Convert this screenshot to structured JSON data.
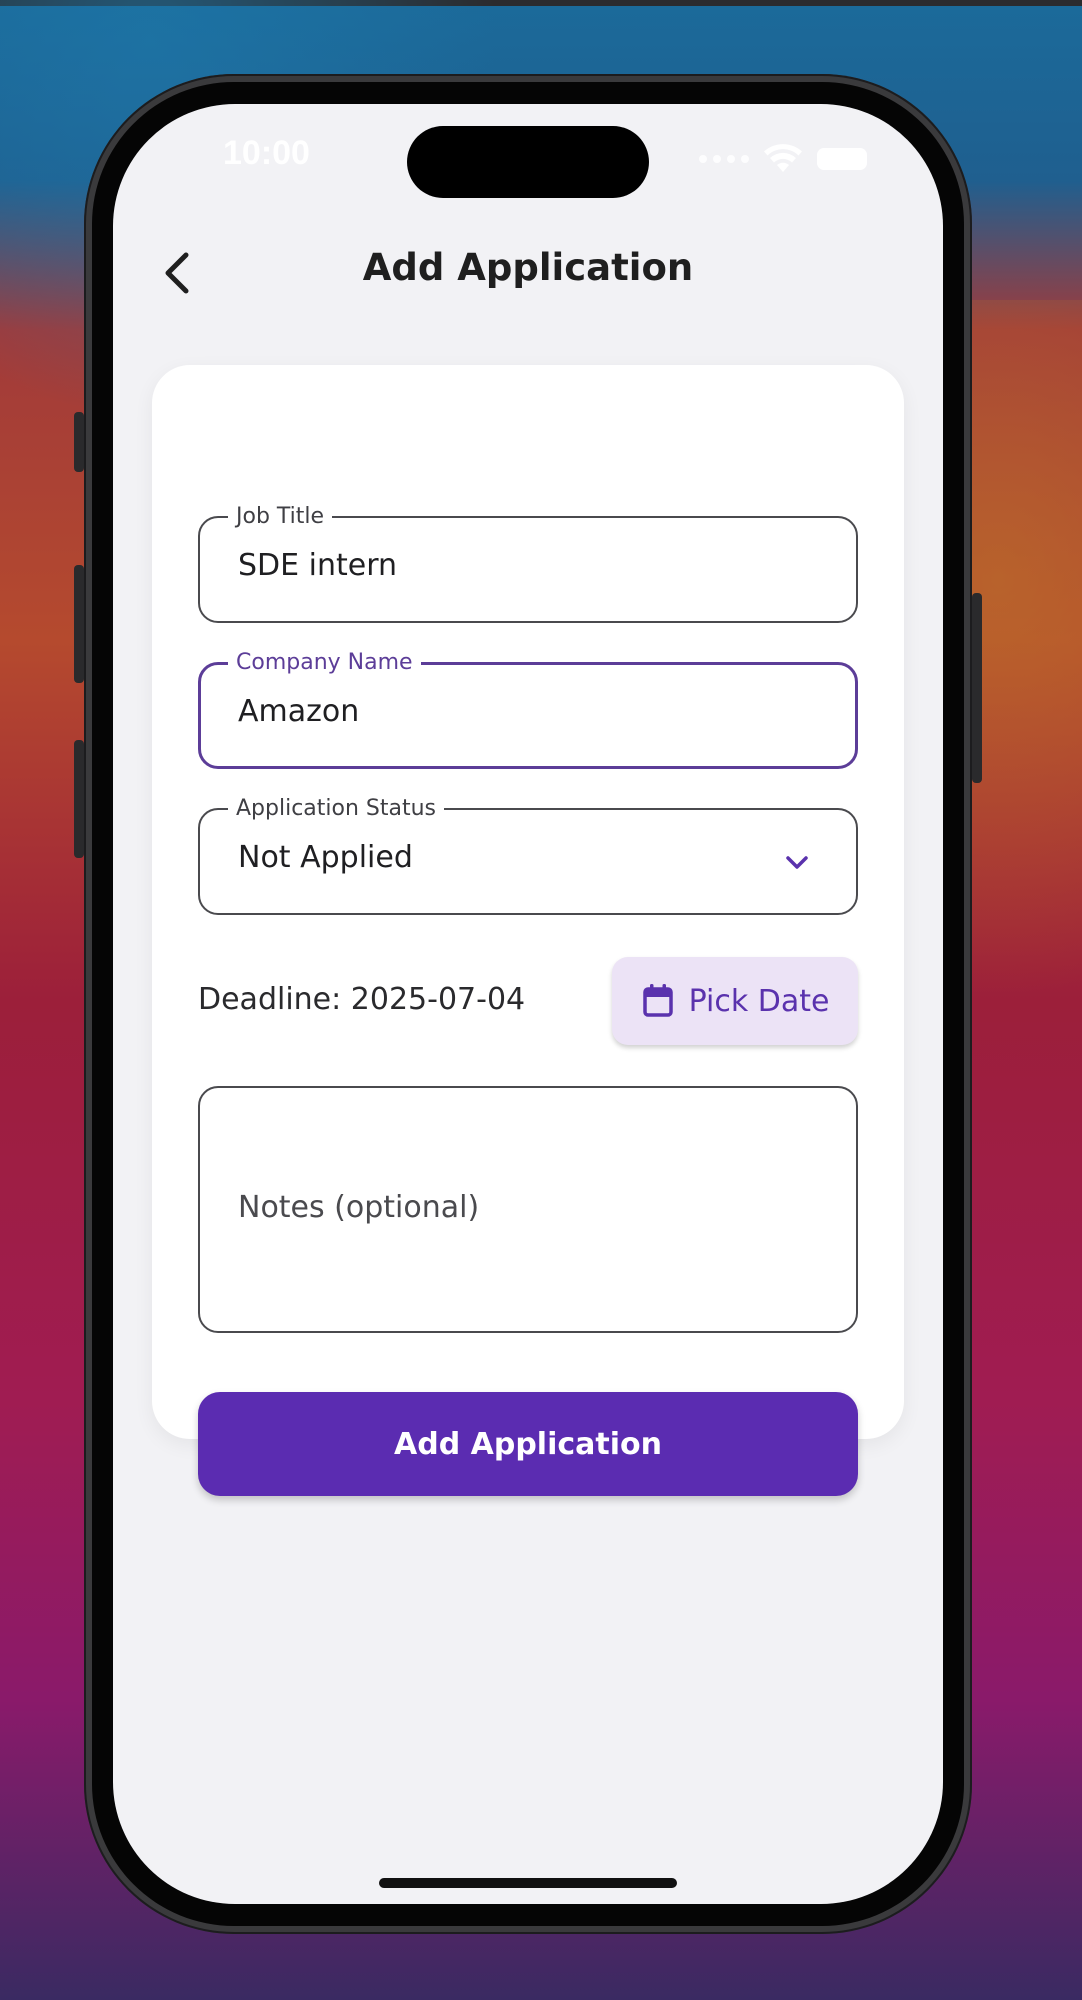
{
  "status_bar": {
    "time": "10:00"
  },
  "header": {
    "title": "Add Application",
    "back_icon": "chevron-left-icon"
  },
  "form": {
    "job_title": {
      "label": "Job Title",
      "value": "SDE intern"
    },
    "company_name": {
      "label": "Company Name",
      "value": "Amazon"
    },
    "application_status": {
      "label": "Application Status",
      "selected": "Not Applied"
    },
    "deadline": {
      "text": "Deadline: 2025-07-04"
    },
    "pick_date_button": {
      "label": "Pick Date",
      "icon": "calendar-icon"
    },
    "notes": {
      "placeholder": "Notes (optional)",
      "value": ""
    },
    "submit_button": {
      "label": "Add Application"
    }
  },
  "colors": {
    "accent": "#5b2cb1",
    "focused_border": "#5c3d98",
    "pick_date_bg": "#ece3f6",
    "screen_bg": "#f2f2f5",
    "card_bg": "#ffffff"
  }
}
